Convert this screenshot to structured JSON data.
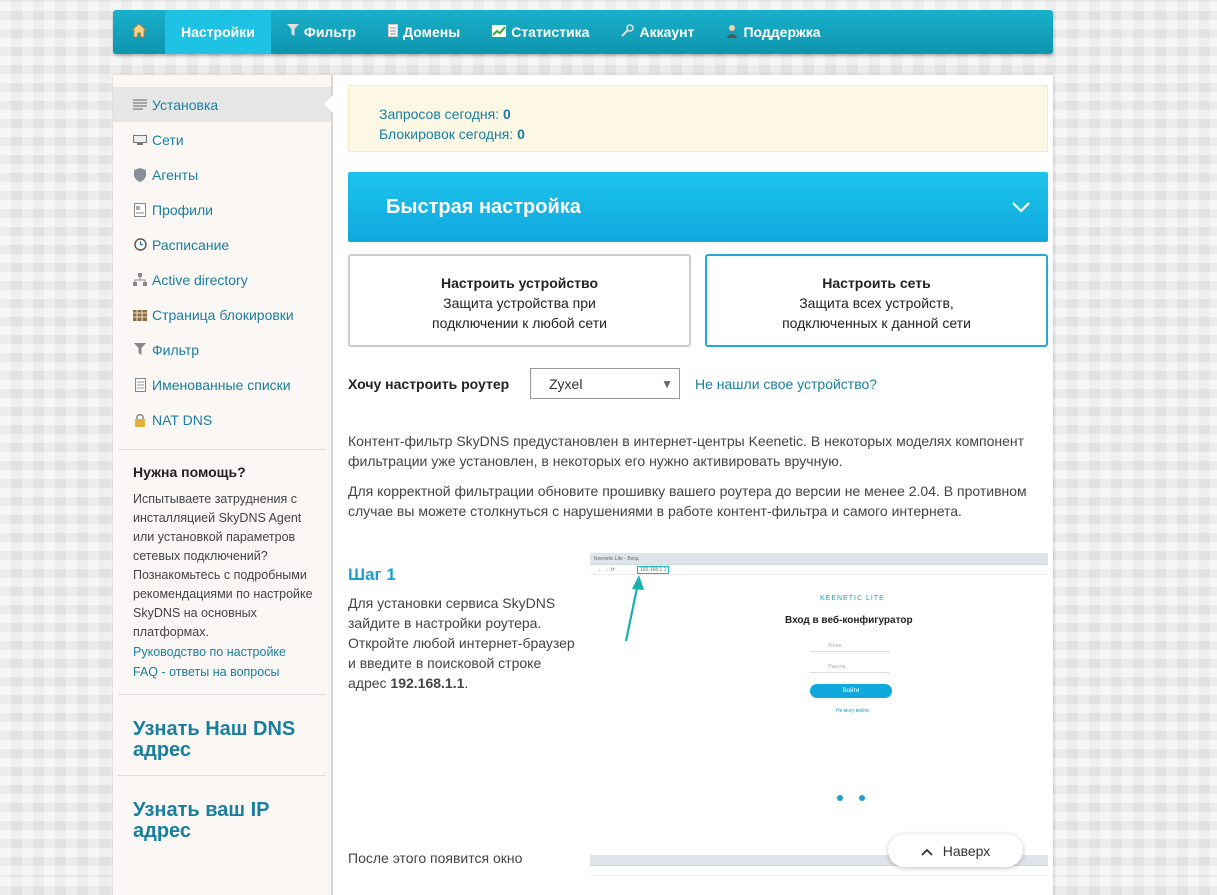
{
  "nav": {
    "home_icon": "home-icon",
    "items": [
      {
        "label": "Настройки",
        "icon": ""
      },
      {
        "label": "Фильтр",
        "icon": "filter-icon"
      },
      {
        "label": "Домены",
        "icon": "document-icon"
      },
      {
        "label": "Статистика",
        "icon": "chart-icon"
      },
      {
        "label": "Аккаунт",
        "icon": "wrench-icon"
      },
      {
        "label": "Поддержка",
        "icon": "person-icon"
      }
    ]
  },
  "sidebar": {
    "items": [
      {
        "label": "Установка",
        "icon": "list-icon"
      },
      {
        "label": "Сети",
        "icon": "network-icon"
      },
      {
        "label": "Агенты",
        "icon": "shield-icon"
      },
      {
        "label": "Профили",
        "icon": "profile-icon"
      },
      {
        "label": "Расписание",
        "icon": "clock-icon"
      },
      {
        "label": "Active directory",
        "icon": "directory-icon"
      },
      {
        "label": "Страница блокировки",
        "icon": "block-page-icon"
      },
      {
        "label": "Фильтр",
        "icon": "filter-icon"
      },
      {
        "label": "Именованные списки",
        "icon": "list-doc-icon"
      },
      {
        "label": "NAT DNS",
        "icon": "lock-icon"
      }
    ],
    "help": {
      "title": "Нужна помощь?",
      "text": "Испытываете затруднения с инсталляцией SkyDNS Agent или установкой параметров сетевых подключений? Познакомьтесь с подробными рекомендациями по настройке SkyDNS на основных платформах.",
      "link1": "Руководство по настройке",
      "link2": "FAQ - ответы на вопросы"
    },
    "dns_link": "Узнать Наш DNS адрес",
    "ip_link": "Узнать ваш IP адрес"
  },
  "stats": {
    "requests_label": "Запросов сегодня:",
    "requests_value": "0",
    "blocks_label": "Блокировок сегодня:",
    "blocks_value": "0"
  },
  "quick": {
    "title": "Быстрая настройка"
  },
  "cards": [
    {
      "title": "Настроить устройство",
      "line1": "Защита устройства при",
      "line2": "подключении к любой сети"
    },
    {
      "title": "Настроить сеть",
      "line1": "Защита всех устройств,",
      "line2": "подключенных к данной сети"
    }
  ],
  "router": {
    "label": "Хочу настроить роутер",
    "selected": "Zyxel",
    "not_found": "Не нашли свое устройство?"
  },
  "paragraphs": [
    "Контент-фильтр SkyDNS предустановлен в интернет-центры Keenetic. В некоторых моделях компонент фильтрации уже установлен, в некоторых его нужно активировать вручную.",
    "Для корректной фильтрации обновите прошивку вашего роутера до версии не менее 2.04. В противном случае вы можете столкнуться с нарушениями в работе контент-фильтра и самого интернета."
  ],
  "step1": {
    "title": "Шаг 1",
    "text_before": "Для установки сервиса SkyDNS зайдите в настройки роутера. Откройте любой интернет-браузер и введите в поисковой строке адрес ",
    "ip": "192.168.1.1",
    "text_after": "."
  },
  "screenshot1": {
    "tab": "Keenetic Lite - Вход",
    "url": "192.168.1.1",
    "brand": "KEENETIC LITE",
    "heading": "Вход в веб-конфигуратор",
    "login_placeholder": "Логин",
    "password_placeholder": "Пароль",
    "button": "Войти",
    "forgot": "Не могу войти"
  },
  "step2": {
    "text": "После этого появится окно"
  },
  "back_to_top": "Наверх",
  "colors": {
    "accent": "#1ec2e3",
    "link": "#1a7f9f"
  }
}
